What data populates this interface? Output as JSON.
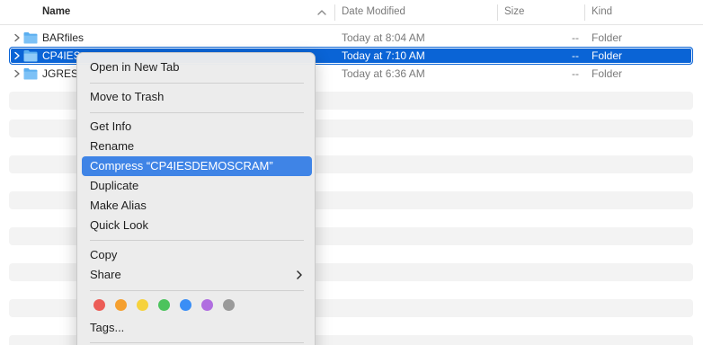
{
  "header": {
    "name_label": "Name",
    "date_label": "Date Modified",
    "size_label": "Size",
    "kind_label": "Kind"
  },
  "rows": [
    {
      "name": "BARfiles",
      "date": "Today at 8:04 AM",
      "size": "--",
      "kind": "Folder",
      "selected": false
    },
    {
      "name": "CP4IES",
      "date": "Today at 7:10 AM",
      "size": "--",
      "kind": "Folder",
      "selected": true
    },
    {
      "name": "JGRES",
      "date": "Today at 6:36 AM",
      "size": "--",
      "kind": "Folder",
      "selected": false
    }
  ],
  "icons": {
    "disclosure": "chevron-right-icon",
    "folder": "folder-icon",
    "sort": "chevron-up-icon",
    "submenu": "chevron-right-icon"
  },
  "colors": {
    "selection": "#0a64d6",
    "menu_highlight": "#3f84e6",
    "folder": "#5aaef0",
    "tags": [
      "#ec5d57",
      "#f5a030",
      "#f6d23d",
      "#4cc35d",
      "#3a8ef6",
      "#b06ee0",
      "#9a9a9a"
    ]
  },
  "menu": {
    "open_new_tab": "Open in New Tab",
    "move_to_trash": "Move to Trash",
    "get_info": "Get Info",
    "rename": "Rename",
    "compress": "Compress “CP4IESDEMOSCRAM”",
    "duplicate": "Duplicate",
    "make_alias": "Make Alias",
    "quick_look": "Quick Look",
    "copy": "Copy",
    "share": "Share",
    "tags": "Tags..."
  }
}
